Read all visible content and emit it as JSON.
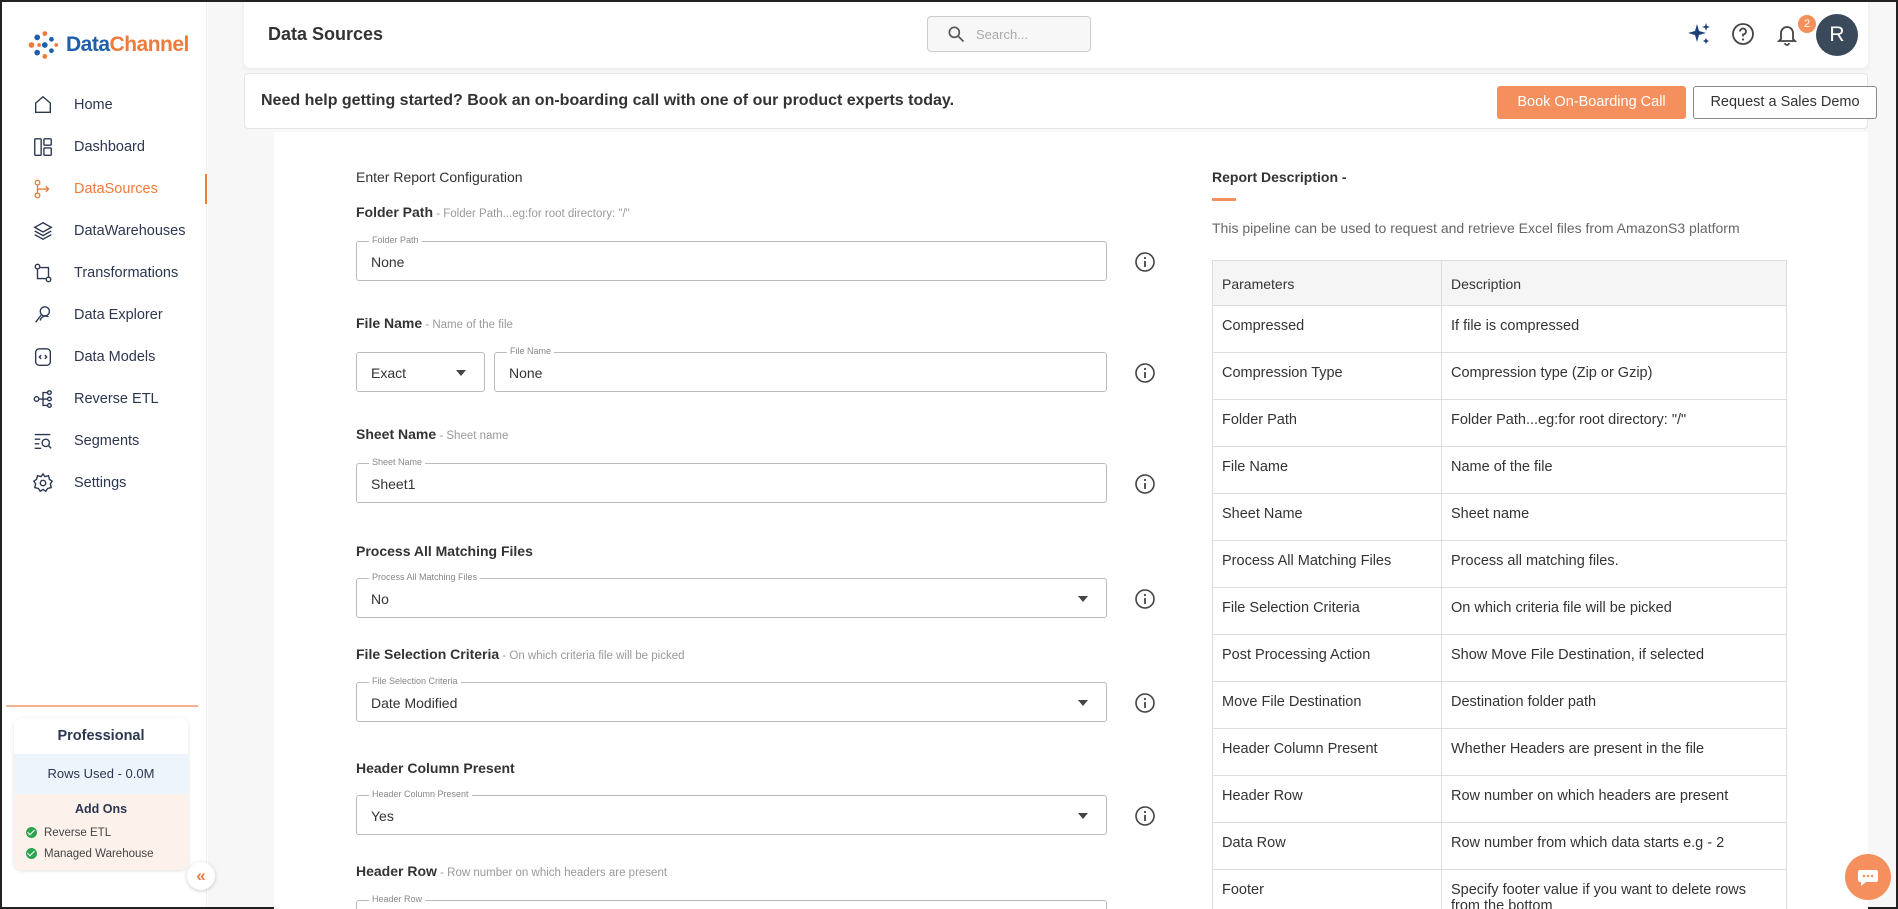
{
  "brand": {
    "name_part1": "Data",
    "name_part2": "Channel"
  },
  "sidebar": {
    "items": [
      {
        "label": "Home",
        "icon": "home-icon"
      },
      {
        "label": "Dashboard",
        "icon": "dashboard-icon"
      },
      {
        "label": "DataSources",
        "icon": "datasources-icon",
        "active": true
      },
      {
        "label": "DataWarehouses",
        "icon": "layers-icon"
      },
      {
        "label": "Transformations",
        "icon": "transform-icon"
      },
      {
        "label": "Data Explorer",
        "icon": "explorer-icon"
      },
      {
        "label": "Data Models",
        "icon": "models-icon"
      },
      {
        "label": "Reverse ETL",
        "icon": "reverse-etl-icon"
      },
      {
        "label": "Segments",
        "icon": "segments-icon"
      },
      {
        "label": "Settings",
        "icon": "gear-icon"
      }
    ],
    "plan": {
      "title": "Professional",
      "rows_used": "Rows Used - 0.0M",
      "addons_title": "Add Ons",
      "addons": [
        "Reverse ETL",
        "Managed Warehouse"
      ]
    },
    "collapse_glyph": "«"
  },
  "header": {
    "title": "Data Sources",
    "search_placeholder": "Search...",
    "notification_count": "2",
    "avatar_initial": "R"
  },
  "banner": {
    "text": "Need help getting started? Book an on-boarding call with one of our product experts today.",
    "book_button": "Book On-Boarding Call",
    "demo_button": "Request a Sales Demo"
  },
  "form": {
    "section_title": "Enter Report Configuration",
    "folder_path": {
      "label": "Folder Path",
      "hint": " - Folder Path...eg:for root directory: \"/\"",
      "legend": "Folder Path",
      "value": "None"
    },
    "file_name": {
      "label": "File Name",
      "hint": " - Name of the file",
      "match_value": "Exact",
      "legend": "File Name",
      "value": "None"
    },
    "sheet_name": {
      "label": "Sheet Name",
      "hint": " - Sheet name",
      "legend": "Sheet Name",
      "value": "Sheet1"
    },
    "process_all": {
      "label": "Process All Matching Files",
      "legend": "Process All Matching Files",
      "value": "No"
    },
    "selection_criteria": {
      "label": "File Selection Criteria",
      "hint": " - On which criteria file will be picked",
      "legend": "File Selection Criteria",
      "value": "Date Modified"
    },
    "header_present": {
      "label": "Header Column Present",
      "legend": "Header Column Present",
      "value": "Yes"
    },
    "header_row": {
      "label": "Header Row",
      "hint": " - Row number on which headers are present",
      "legend": "Header Row"
    }
  },
  "description": {
    "title": "Report Description -",
    "text": "This pipeline can be used to request and retrieve Excel files from AmazonS3 platform",
    "headers": [
      "Parameters",
      "Description"
    ],
    "rows": [
      [
        "Compressed",
        "If file is compressed"
      ],
      [
        "Compression Type",
        "Compression type (Zip or Gzip)"
      ],
      [
        "Folder Path",
        "Folder Path...eg:for root directory: \"/\""
      ],
      [
        "File Name",
        "Name of the file"
      ],
      [
        "Sheet Name",
        "Sheet name"
      ],
      [
        "Process All Matching Files",
        "Process all matching files."
      ],
      [
        "File Selection Criteria",
        "On which criteria file will be picked"
      ],
      [
        "Post Processing Action",
        "Show Move File Destination, if selected"
      ],
      [
        "Move File Destination",
        "Destination folder path"
      ],
      [
        "Header Column Present",
        "Whether Headers are present in the file"
      ],
      [
        "Header Row",
        "Row number on which headers are present"
      ],
      [
        "Data Row",
        "Row number from which data starts e.g - 2"
      ],
      [
        "Footer",
        "Specify footer value if you want to delete rows from the bottom"
      ]
    ]
  },
  "colors": {
    "accent": "#f07a3a",
    "button": "#f58f5d",
    "nav_text": "#2b3650"
  }
}
